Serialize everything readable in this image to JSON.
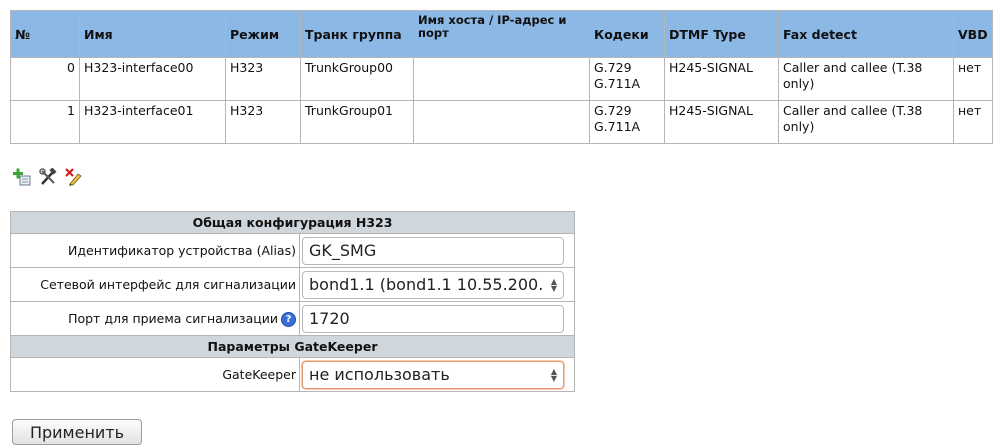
{
  "table": {
    "headers": [
      "№",
      "Имя",
      "Режим",
      "Транк группа",
      "Имя хоста / IP-адрес и порт",
      "Кодеки",
      "DTMF Type",
      "Fax detect",
      "VBD"
    ],
    "rows": [
      {
        "num": "0",
        "name": "H323-interface00",
        "mode": "H323",
        "trunk": "TrunkGroup00",
        "host": "",
        "codec1": "G.729",
        "codec2": "G.711A",
        "dtmf": "H245-SIGNAL",
        "fax": "Caller and callee (T.38 only)",
        "vbd": "нет"
      },
      {
        "num": "1",
        "name": "H323-interface01",
        "mode": "H323",
        "trunk": "TrunkGroup01",
        "host": "",
        "codec1": "G.729",
        "codec2": "G.711A",
        "dtmf": "H245-SIGNAL",
        "fax": "Caller and callee (T.38 only)",
        "vbd": "нет"
      }
    ]
  },
  "toolbar": {
    "icons": [
      "add-icon",
      "edit-tools-icon",
      "delete-icon"
    ]
  },
  "config": {
    "section1_title": "Общая конфигурация H323",
    "alias_label": "Идентификатор устройства (Alias)",
    "alias_value": "GK_SMG",
    "netif_label": "Сетевой интерфейс для сигнализации",
    "netif_value": "bond1.1 (bond1.1 10.55.200.",
    "port_label": "Порт для приема сигнализации",
    "port_value": "1720",
    "section2_title": "Параметры GateKeeper",
    "gk_label": "GateKeeper",
    "gk_value": "не использовать"
  },
  "apply_label": "Применить",
  "colors": {
    "header_bg": "#8cb8e6",
    "section_bg": "#cfd6dc",
    "focus_border": "#e29a72"
  }
}
